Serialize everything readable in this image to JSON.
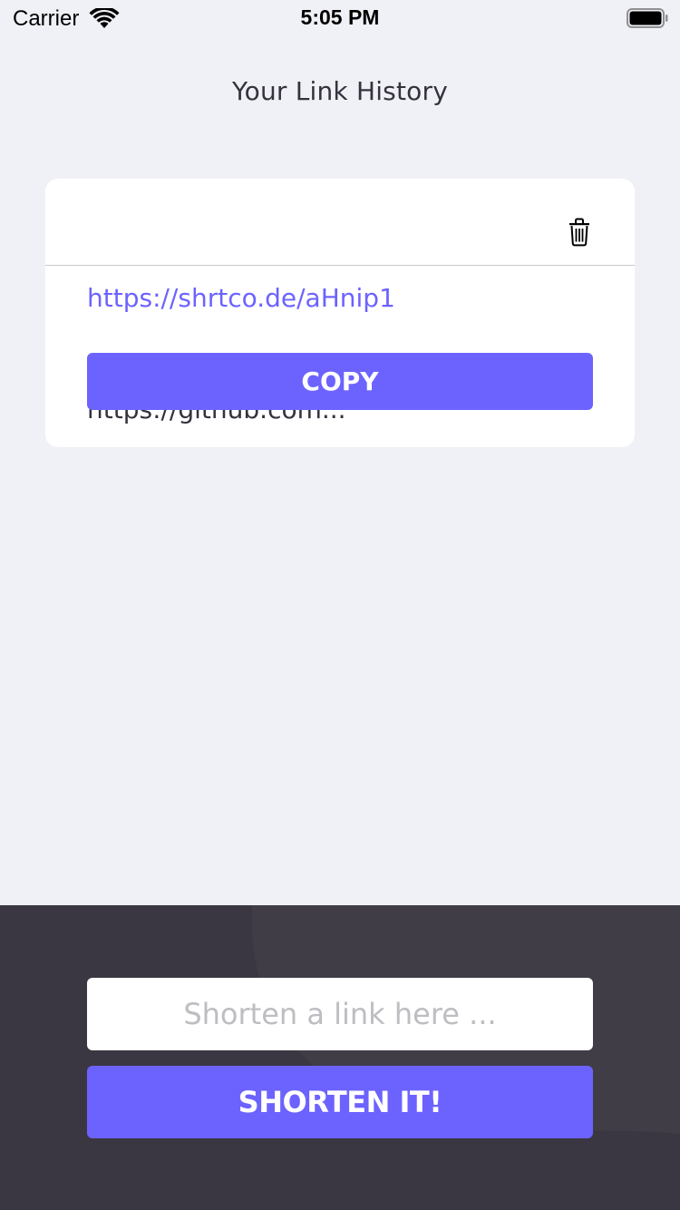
{
  "status_bar": {
    "carrier": "Carrier",
    "time": "5:05 PM",
    "wifi_icon": "wifi-icon",
    "battery_icon": "battery-full-icon"
  },
  "header": {
    "title": "Your Link History"
  },
  "history": {
    "items": [
      {
        "original_url": "https://github.com...",
        "short_url": "https://shrtco.de/aHnip1",
        "copy_label": "COPY",
        "delete_icon": "trash-icon"
      }
    ]
  },
  "shorten_form": {
    "placeholder": "Shorten a link here ...",
    "value": "",
    "button_label": "SHORTEN IT!"
  },
  "colors": {
    "accent": "#6C63FF",
    "background": "#F0F1F6",
    "panel": "#3A3742",
    "text_dark": "#35323E",
    "placeholder": "#BDBDC2"
  }
}
